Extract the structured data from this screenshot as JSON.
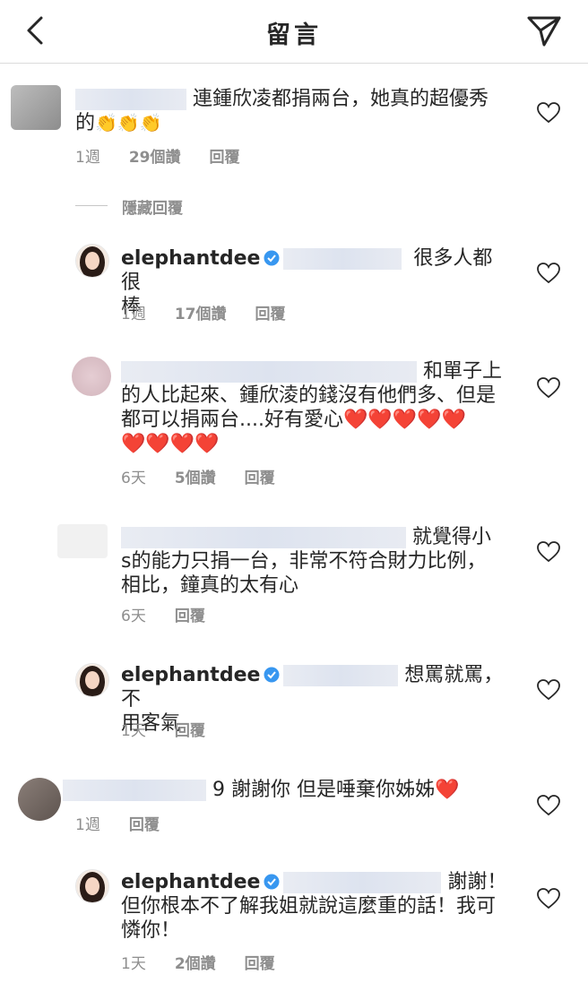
{
  "header": {
    "title": "留言",
    "back_icon": "chevron-left-icon",
    "send_icon": "paper-plane-icon"
  },
  "hidden_replies_label": "隱藏回覆",
  "comments": [
    {
      "text": "連鍾欣凌都捐兩台，她真的超優秀",
      "text2": "的",
      "emoji": "👏👏👏",
      "time": "1週",
      "likes": "29個讚",
      "reply": "回覆"
    },
    {
      "user": "elephantdee",
      "text": "很多人都很",
      "text2": "棒",
      "time": "1週",
      "likes": "17個讚",
      "reply": "回覆"
    },
    {
      "text": "和單子上",
      "text2": "的人比起來、鍾欣淩的錢沒有他們多、但是",
      "text3": "都可以捐兩台....好有愛心",
      "hearts1": "❤️❤️❤️❤️❤️",
      "hearts2": "❤️❤️❤️❤️",
      "time": "6天",
      "likes": "5個讚",
      "reply": "回覆"
    },
    {
      "text": "就覺得小",
      "text2": "s的能力只捐一台，非常不符合財力比例，",
      "text3": "相比，鐘真的太有心",
      "time": "6天",
      "reply": "回覆"
    },
    {
      "user": "elephantdee",
      "text": "想罵就罵，不",
      "text2": "用客氣",
      "time": "1天",
      "reply": "回覆"
    },
    {
      "text": "9 謝謝你 但是唾棄你姊姊",
      "heart": "❤️",
      "time": "1週",
      "reply": "回覆"
    },
    {
      "user": "elephantdee",
      "text": "謝謝！",
      "text2": "但你根本不了解我姐就說這麼重的話！我可",
      "text3": "憐你！",
      "time": "1天",
      "likes": "2個讚",
      "reply": "回覆"
    }
  ],
  "colors": {
    "heart_red": "#e0243b",
    "muted": "#8e8e8e",
    "verified_blue": "#3897f0"
  }
}
